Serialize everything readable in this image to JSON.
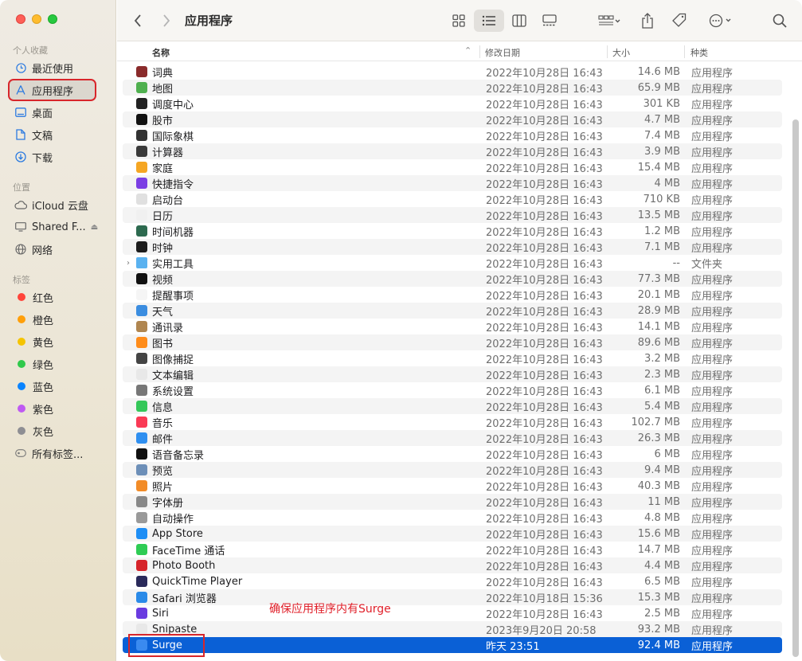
{
  "window": {
    "title": "应用程序",
    "accent": "#0a60d6"
  },
  "sidebar": {
    "favorites_title": "个人收藏",
    "locations_title": "位置",
    "tags_title": "标签",
    "favorites": [
      {
        "label": "最近使用",
        "icon": "clock-icon"
      },
      {
        "label": "应用程序",
        "icon": "apps-icon",
        "selected": true
      },
      {
        "label": "桌面",
        "icon": "desktop-icon"
      },
      {
        "label": "文稿",
        "icon": "document-icon"
      },
      {
        "label": "下载",
        "icon": "download-icon"
      }
    ],
    "locations": [
      {
        "label": "iCloud 云盘",
        "icon": "cloud-icon"
      },
      {
        "label": "Shared F...",
        "icon": "display-icon"
      },
      {
        "label": "网络",
        "icon": "globe-icon"
      }
    ],
    "tags": [
      {
        "label": "红色",
        "color": "#ff453a"
      },
      {
        "label": "橙色",
        "color": "#ff9f0a"
      },
      {
        "label": "黄色",
        "color": "#f5c400"
      },
      {
        "label": "绿色",
        "color": "#30c94b"
      },
      {
        "label": "蓝色",
        "color": "#0a84ff"
      },
      {
        "label": "紫色",
        "color": "#bf5af2"
      },
      {
        "label": "灰色",
        "color": "#8e8e93"
      },
      {
        "label": "所有标签...",
        "color": ""
      }
    ]
  },
  "columns": {
    "name": "名称",
    "date": "修改日期",
    "size": "大小",
    "kind": "种类"
  },
  "files": [
    {
      "name": "词典",
      "date": "2022年10月28日 16:43",
      "size": "14.6 MB",
      "kind": "应用程序",
      "color": "#8a2b2b"
    },
    {
      "name": "地图",
      "date": "2022年10月28日 16:43",
      "size": "65.9 MB",
      "kind": "应用程序",
      "color": "#4fb04f"
    },
    {
      "name": "调度中心",
      "date": "2022年10月28日 16:43",
      "size": "301 KB",
      "kind": "应用程序",
      "color": "#222"
    },
    {
      "name": "股市",
      "date": "2022年10月28日 16:43",
      "size": "4.7 MB",
      "kind": "应用程序",
      "color": "#111"
    },
    {
      "name": "国际象棋",
      "date": "2022年10月28日 16:43",
      "size": "7.4 MB",
      "kind": "应用程序",
      "color": "#333"
    },
    {
      "name": "计算器",
      "date": "2022年10月28日 16:43",
      "size": "3.9 MB",
      "kind": "应用程序",
      "color": "#3a3a3a"
    },
    {
      "name": "家庭",
      "date": "2022年10月28日 16:43",
      "size": "15.4 MB",
      "kind": "应用程序",
      "color": "#f5a623"
    },
    {
      "name": "快捷指令",
      "date": "2022年10月28日 16:43",
      "size": "4 MB",
      "kind": "应用程序",
      "color": "#7b3fe4"
    },
    {
      "name": "启动台",
      "date": "2022年10月28日 16:43",
      "size": "710 KB",
      "kind": "应用程序",
      "color": "#e0e0e0"
    },
    {
      "name": "日历",
      "date": "2022年10月28日 16:43",
      "size": "13.5 MB",
      "kind": "应用程序",
      "color": "#f0f0f0"
    },
    {
      "name": "时间机器",
      "date": "2022年10月28日 16:43",
      "size": "1.2 MB",
      "kind": "应用程序",
      "color": "#2d6a4f"
    },
    {
      "name": "时钟",
      "date": "2022年10月28日 16:43",
      "size": "7.1 MB",
      "kind": "应用程序",
      "color": "#1c1c1c"
    },
    {
      "name": "实用工具",
      "date": "2022年10月28日 16:43",
      "size": "--",
      "kind": "文件夹",
      "color": "#5ab2f0",
      "folder": true
    },
    {
      "name": "视频",
      "date": "2022年10月28日 16:43",
      "size": "77.3 MB",
      "kind": "应用程序",
      "color": "#111"
    },
    {
      "name": "提醒事项",
      "date": "2022年10月28日 16:43",
      "size": "20.1 MB",
      "kind": "应用程序",
      "color": "#f5f5f5"
    },
    {
      "name": "天气",
      "date": "2022年10月28日 16:43",
      "size": "28.9 MB",
      "kind": "应用程序",
      "color": "#3b8de0"
    },
    {
      "name": "通讯录",
      "date": "2022年10月28日 16:43",
      "size": "14.1 MB",
      "kind": "应用程序",
      "color": "#b08650"
    },
    {
      "name": "图书",
      "date": "2022年10月28日 16:43",
      "size": "89.6 MB",
      "kind": "应用程序",
      "color": "#ff8c1a"
    },
    {
      "name": "图像捕捉",
      "date": "2022年10月28日 16:43",
      "size": "3.2 MB",
      "kind": "应用程序",
      "color": "#444"
    },
    {
      "name": "文本编辑",
      "date": "2022年10月28日 16:43",
      "size": "2.3 MB",
      "kind": "应用程序",
      "color": "#e8e8e8"
    },
    {
      "name": "系统设置",
      "date": "2022年10月28日 16:43",
      "size": "6.1 MB",
      "kind": "应用程序",
      "color": "#777"
    },
    {
      "name": "信息",
      "date": "2022年10月28日 16:43",
      "size": "5.4 MB",
      "kind": "应用程序",
      "color": "#34c759"
    },
    {
      "name": "音乐",
      "date": "2022年10月28日 16:43",
      "size": "102.7 MB",
      "kind": "应用程序",
      "color": "#fa3a55"
    },
    {
      "name": "邮件",
      "date": "2022年10月28日 16:43",
      "size": "26.3 MB",
      "kind": "应用程序",
      "color": "#2f8ff0"
    },
    {
      "name": "语音备忘录",
      "date": "2022年10月28日 16:43",
      "size": "6 MB",
      "kind": "应用程序",
      "color": "#111"
    },
    {
      "name": "预览",
      "date": "2022年10月28日 16:43",
      "size": "9.4 MB",
      "kind": "应用程序",
      "color": "#6d8fb8"
    },
    {
      "name": "照片",
      "date": "2022年10月28日 16:43",
      "size": "40.3 MB",
      "kind": "应用程序",
      "color": "#f28c28"
    },
    {
      "name": "字体册",
      "date": "2022年10月28日 16:43",
      "size": "11 MB",
      "kind": "应用程序",
      "color": "#888"
    },
    {
      "name": "自动操作",
      "date": "2022年10月28日 16:43",
      "size": "4.8 MB",
      "kind": "应用程序",
      "color": "#9a9a9a"
    },
    {
      "name": "App Store",
      "date": "2022年10月28日 16:43",
      "size": "15.6 MB",
      "kind": "应用程序",
      "color": "#1e8ef5"
    },
    {
      "name": "FaceTime 通话",
      "date": "2022年10月28日 16:43",
      "size": "14.7 MB",
      "kind": "应用程序",
      "color": "#2ecc54"
    },
    {
      "name": "Photo Booth",
      "date": "2022年10月28日 16:43",
      "size": "4.4 MB",
      "kind": "应用程序",
      "color": "#d6242a"
    },
    {
      "name": "QuickTime Player",
      "date": "2022年10月28日 16:43",
      "size": "6.5 MB",
      "kind": "应用程序",
      "color": "#2a2a5a"
    },
    {
      "name": "Safari 浏览器",
      "date": "2022年10月18日 15:36",
      "size": "15.3 MB",
      "kind": "应用程序",
      "color": "#2a8ae8"
    },
    {
      "name": "Siri",
      "date": "2022年10月28日 16:43",
      "size": "2.5 MB",
      "kind": "应用程序",
      "color": "#6a3be0"
    },
    {
      "name": "Snipaste",
      "date": "2023年9月20日 20:58",
      "size": "93.2 MB",
      "kind": "应用程序",
      "color": "#e8e8e8"
    },
    {
      "name": "Surge",
      "date": "昨天 23:51",
      "size": "92.4 MB",
      "kind": "应用程序",
      "color": "#3a8af0",
      "selected": true
    }
  ],
  "annotation": "确保应用程序内有Surge"
}
